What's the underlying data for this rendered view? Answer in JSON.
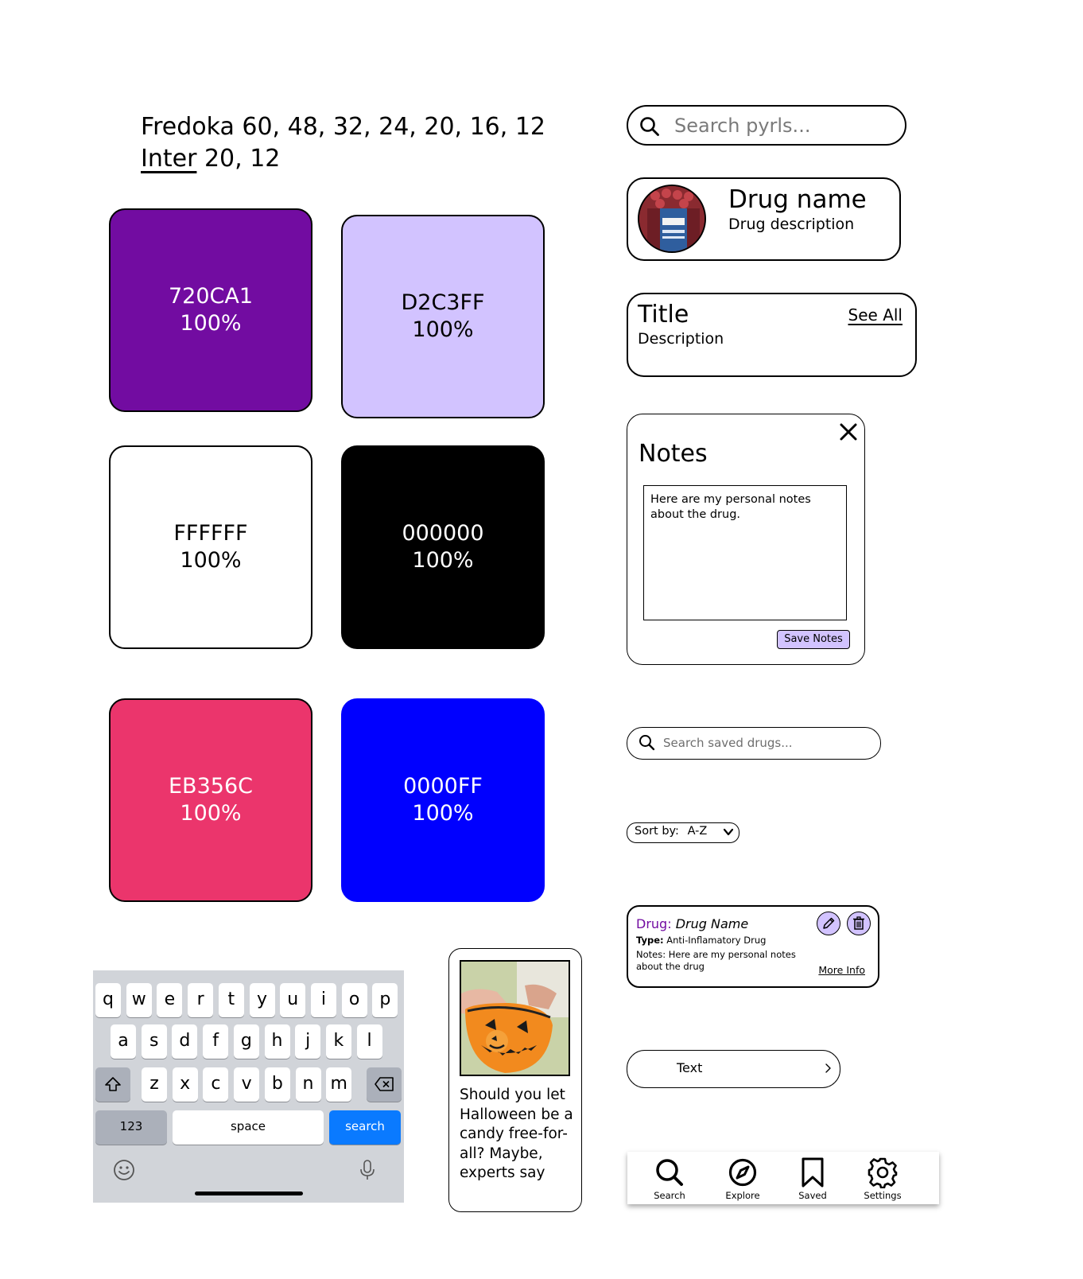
{
  "typography": {
    "fredoka": "Fredoka 60, 48, 32, 24, 20, 16, 12",
    "inter_name": "Inter",
    "inter_sizes": " 20, 12"
  },
  "colors": [
    {
      "hex": "720CA1",
      "opacity": "100%",
      "fill": "#720CA1",
      "text_color": "#ffffff"
    },
    {
      "hex": "D2C3FF",
      "opacity": "100%",
      "fill": "#D2C3FF",
      "text_color": "#000000"
    },
    {
      "hex": "FFFFFF",
      "opacity": "100%",
      "fill": "#FFFFFF",
      "text_color": "#000000"
    },
    {
      "hex": "000000",
      "opacity": "100%",
      "fill": "#000000",
      "text_color": "#ffffff"
    },
    {
      "hex": "EB356C",
      "opacity": "100%",
      "fill": "#EB356C",
      "text_color": "#ffffff"
    },
    {
      "hex": "0000FF",
      "opacity": "100%",
      "fill": "#0000FF",
      "text_color": "#ffffff"
    }
  ],
  "search_main": {
    "placeholder": "Search pyrls...",
    "icon": "search-icon"
  },
  "drug_card": {
    "name": "Drug name",
    "description": "Drug description",
    "image": "ibuprofen-bottle-photo"
  },
  "title_card": {
    "title": "Title",
    "description": "Description",
    "see_all": "See All"
  },
  "notes_modal": {
    "title": "Notes",
    "body": "Here are my personal notes about the drug.",
    "save_label": "Save Notes",
    "close_icon": "close-icon"
  },
  "search_saved": {
    "placeholder": "Search saved drugs..."
  },
  "sort": {
    "label": "Sort by:",
    "value": "A-Z"
  },
  "saved_card": {
    "drug_key": "Drug:",
    "drug_value": "Drug Name",
    "type_key": "Type:",
    "type_value": "Anti-Inflamatory Drug",
    "notes": "Notes: Here are my personal notes about the drug",
    "more_info": "More Info",
    "edit_icon": "pencil-icon",
    "delete_icon": "trash-icon"
  },
  "list_row": {
    "label": "Text"
  },
  "tab_bar": {
    "tabs": [
      {
        "label": "Search",
        "icon": "search-icon"
      },
      {
        "label": "Explore",
        "icon": "compass-icon"
      },
      {
        "label": "Saved",
        "icon": "bookmark-icon"
      },
      {
        "label": "Settings",
        "icon": "gear-icon"
      }
    ]
  },
  "keyboard": {
    "row1": [
      "q",
      "w",
      "e",
      "r",
      "t",
      "y",
      "u",
      "i",
      "o",
      "p"
    ],
    "row2": [
      "a",
      "s",
      "d",
      "f",
      "g",
      "h",
      "j",
      "k",
      "l"
    ],
    "row3": [
      "z",
      "x",
      "c",
      "v",
      "b",
      "n",
      "m"
    ],
    "numbers": "123",
    "space": "space",
    "action": "search"
  },
  "article": {
    "headline": "Should you let Halloween be a candy free-for-all? Maybe, experts say",
    "image": "halloween-pumpkin-bucket-photo"
  }
}
